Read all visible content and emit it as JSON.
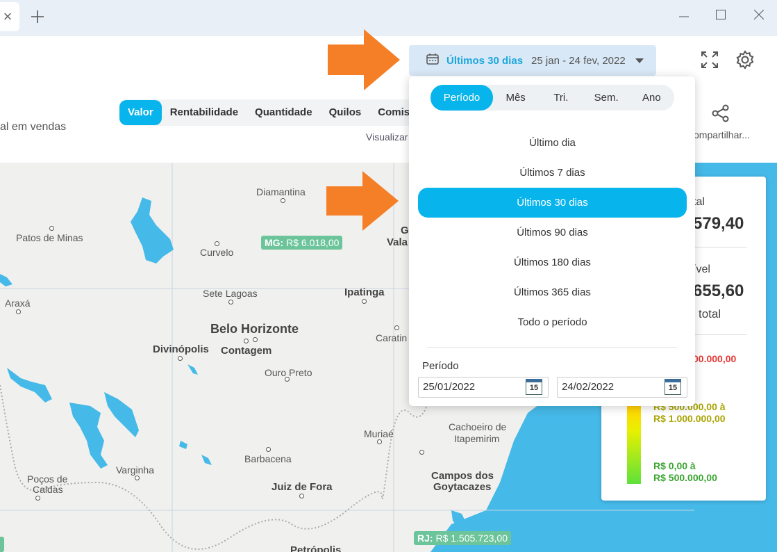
{
  "browser": {
    "tab_close": "×",
    "new_tab": "+"
  },
  "header": {
    "subtitle": "al em vendas",
    "metric_tabs": [
      "Valor",
      "Rentabilidade",
      "Quantidade",
      "Quilos",
      "Comissõ"
    ],
    "visualizar": "Visualizar",
    "date_selector": {
      "label": "Últimos 30 dias",
      "range": "25 jan - 24 fev, 2022"
    },
    "share_label": "ompartilhar..."
  },
  "dropdown": {
    "segments": [
      "Período",
      "Mês",
      "Tri.",
      "Sem.",
      "Ano"
    ],
    "options": [
      "Último dia",
      "Últimos 7 dias",
      "Últimos 30 dias",
      "Últimos 90 dias",
      "Últimos 180 dias",
      "Últimos 365 dias",
      "Todo o período"
    ],
    "selected_option": "Últimos 30 dias",
    "period_label": "Período",
    "start_date": "25/01/2022",
    "end_date": "24/02/2022",
    "calendar_day": "15"
  },
  "map": {
    "cities": [
      "Diamantina",
      "Patos de Minas",
      "Curvelo",
      "Araxá",
      "Sete Lagoas",
      "Ipatinga",
      "Belo Horizonte",
      "Divinópolis",
      "Contagem",
      "Ouro Preto",
      "Caratin",
      "Gc",
      "Vala",
      "Muriaé",
      "Cachoeiro de",
      "Itapemirim",
      "Barbacena",
      "Varginha",
      "Poços de",
      "Caldas",
      "Juiz de Fora",
      "Campos dos",
      "Goytacazes",
      "Petrópolis"
    ],
    "badges": {
      "mg": "MG:",
      "mg_value": "R$ 6.018,00",
      "rj": "RJ:",
      "rj_value": "R$ 1.505.723,00"
    }
  },
  "legend": {
    "label1": "tal",
    "value1": "579,40",
    "label2": "ível",
    "value2": "655,60",
    "label3": "total",
    "tier_top": "00.000,00",
    "tier_mid_a": "R$ 500.000,00 à",
    "tier_mid_b": "R$ 1.000.000,00",
    "tier_low_a": "R$ 0,00 à",
    "tier_low_b": "R$ 500.000,00",
    "colors": {
      "red": "#e53935",
      "olive": "#a8a400",
      "green": "#3aa530"
    }
  },
  "colors": {
    "accent": "#08b4ec",
    "arrow": "#f57f26",
    "badge": "#6cc49a"
  }
}
